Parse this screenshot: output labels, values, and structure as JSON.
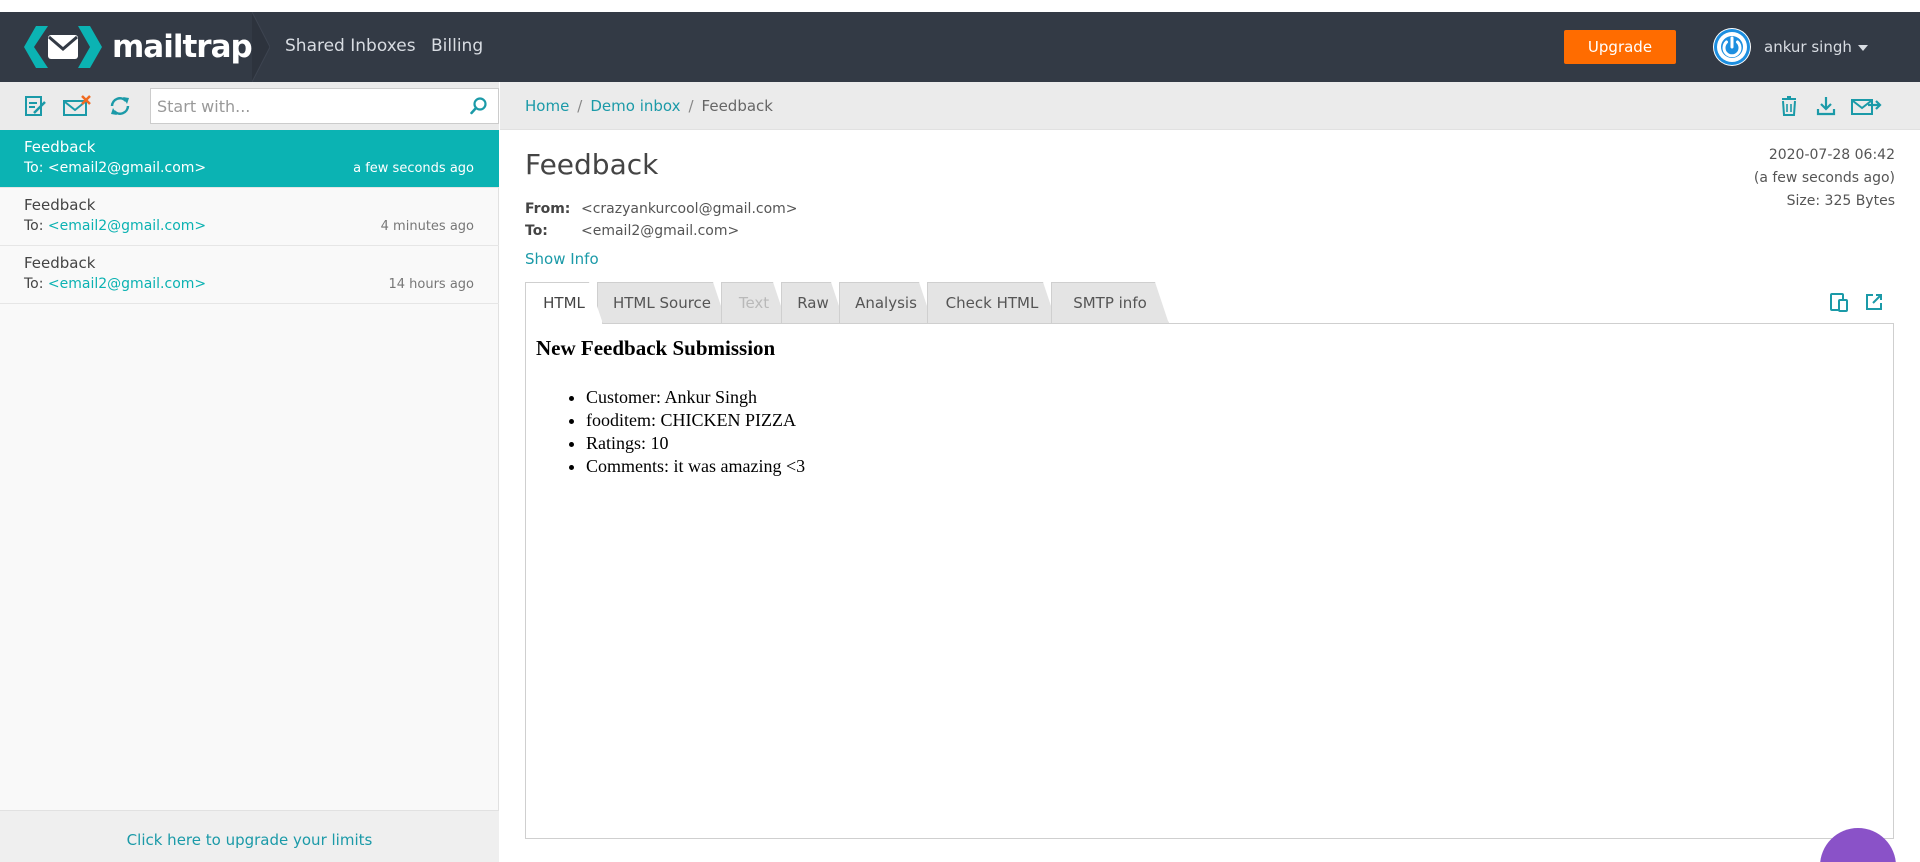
{
  "brand": {
    "name": "mailtrap",
    "accent": "#0bb3b3",
    "topbar_color": "#333a45"
  },
  "nav": {
    "items": [
      "Shared Inboxes",
      "Billing"
    ]
  },
  "upgrade_label": "Upgrade",
  "user": {
    "name": "ankur singh"
  },
  "search": {
    "placeholder": "Start with..."
  },
  "toolbar_icons": [
    "compose-icon",
    "clear-inbox-icon",
    "refresh-icon"
  ],
  "messages": [
    {
      "subject": "Feedback",
      "to_label": "To:",
      "to": "<email2@gmail.com>",
      "time": "a few seconds ago",
      "active": true
    },
    {
      "subject": "Feedback",
      "to_label": "To:",
      "to": "<email2@gmail.com>",
      "time": "4 minutes ago",
      "active": false
    },
    {
      "subject": "Feedback",
      "to_label": "To:",
      "to": "<email2@gmail.com>",
      "time": "14 hours ago",
      "active": false
    }
  ],
  "footer_link": "Click here to upgrade your limits",
  "breadcrumb": [
    "Home",
    "Demo inbox",
    "Feedback"
  ],
  "message": {
    "title": "Feedback",
    "date": "2020-07-28 06:42",
    "relative": "(a few seconds ago)",
    "size": "Size: 325 Bytes",
    "from_label": "From:",
    "from": "<crazyankurcool@gmail.com>",
    "to_label": "To:",
    "to": "<email2@gmail.com>",
    "show_info": "Show Info"
  },
  "tabs": [
    {
      "label": "HTML",
      "state": "active"
    },
    {
      "label": "HTML Source",
      "state": "normal"
    },
    {
      "label": "Text",
      "state": "disabled"
    },
    {
      "label": "Raw",
      "state": "normal"
    },
    {
      "label": "Analysis",
      "state": "normal"
    },
    {
      "label": "Check HTML",
      "state": "normal"
    },
    {
      "label": "SMTP info",
      "state": "normal"
    }
  ],
  "preview": {
    "heading": "New Feedback Submission",
    "items": [
      "Customer: Ankur Singh",
      "fooditem: CHICKEN PIZZA",
      "Ratings: 10",
      "Comments: it was amazing <3"
    ]
  }
}
